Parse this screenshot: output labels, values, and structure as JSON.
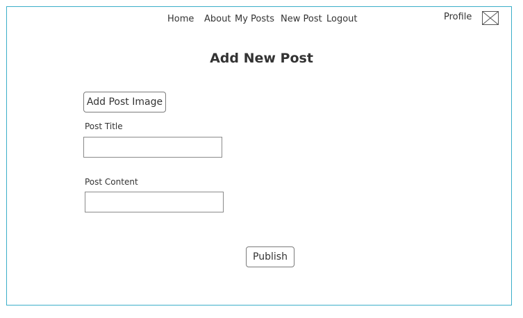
{
  "nav": {
    "items": [
      {
        "label": "Home"
      },
      {
        "label": "About"
      },
      {
        "label": "My Posts"
      },
      {
        "label": "New Post"
      },
      {
        "label": "Logout"
      }
    ],
    "profile_label": "Profile",
    "profile_icon": "image-placeholder-icon"
  },
  "main": {
    "title": "Add New Post",
    "add_image_label": "Add Post Image",
    "post_title": {
      "label": "Post Title",
      "value": "",
      "placeholder": ""
    },
    "post_content": {
      "label": "Post Content",
      "value": "",
      "placeholder": ""
    },
    "publish_label": "Publish"
  },
  "colors": {
    "frame_border": "#3aaec9",
    "text": "#333333",
    "control_border": "#7a7a7a"
  }
}
